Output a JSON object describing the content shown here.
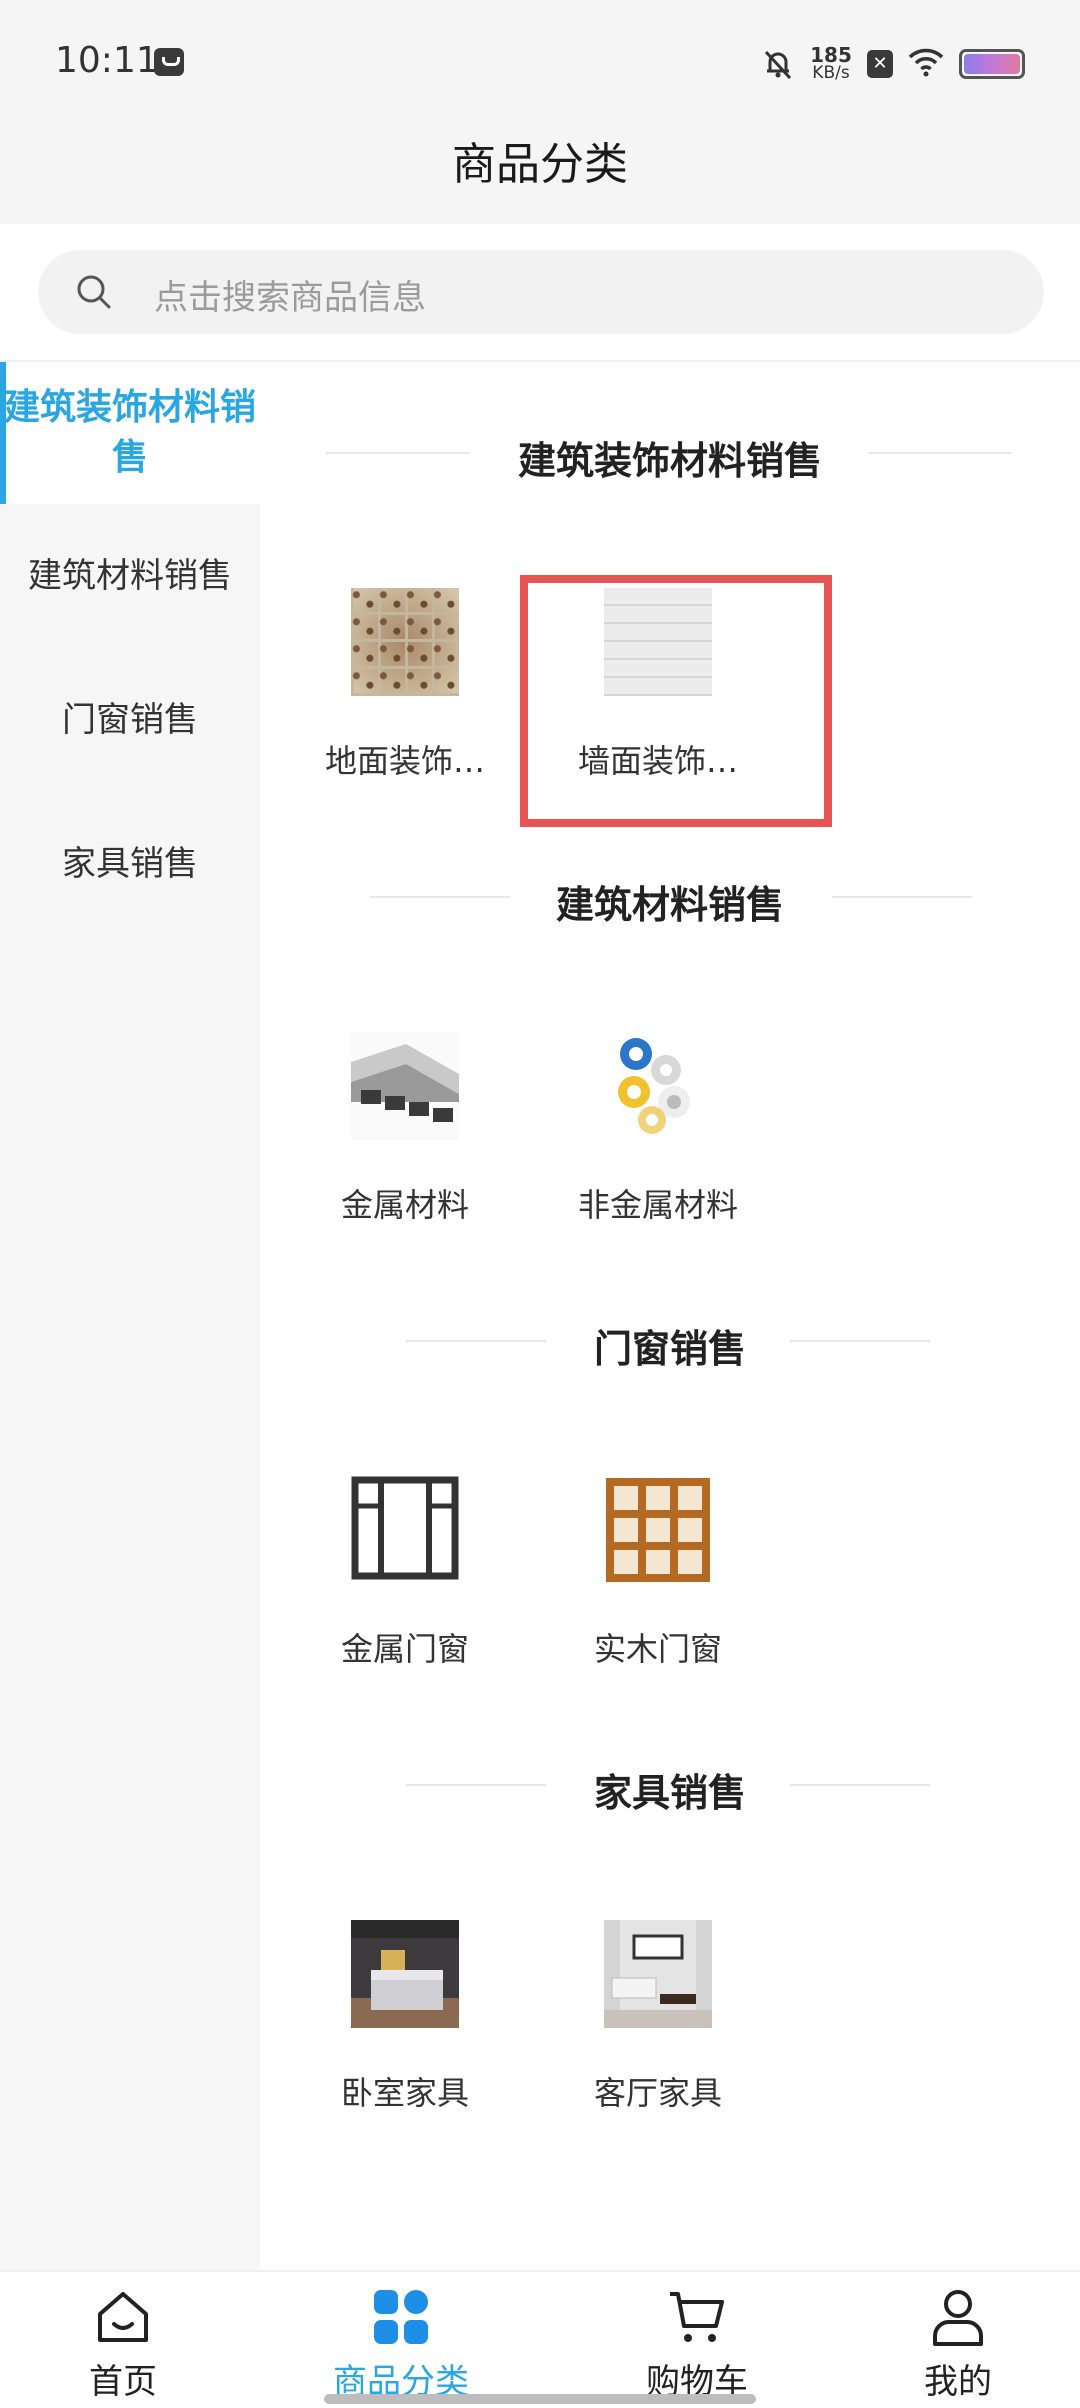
{
  "status_bar": {
    "time": "10:11",
    "net_speed_value": "185",
    "net_speed_unit": "KB/s"
  },
  "header": {
    "title": "商品分类"
  },
  "search": {
    "placeholder": "点击搜索商品信息"
  },
  "sidebar": {
    "items": [
      {
        "label": "建筑装饰材料销售",
        "active": true
      },
      {
        "label": "建筑材料销售",
        "active": false
      },
      {
        "label": "门窗销售",
        "active": false
      },
      {
        "label": "家具销售",
        "active": false
      }
    ]
  },
  "sections": [
    {
      "title": "建筑装饰材料销售",
      "items": [
        {
          "label": "地面装饰…",
          "image": "floor-tile-image"
        },
        {
          "label": "墙面装饰…",
          "image": "white-brick-wall-image"
        }
      ]
    },
    {
      "title": "建筑材料销售",
      "items": [
        {
          "label": "金属材料",
          "image": "metal-tube-image"
        },
        {
          "label": "非金属材料",
          "image": "tape-rolls-image"
        }
      ]
    },
    {
      "title": "门窗销售",
      "items": [
        {
          "label": "金属门窗",
          "image": "metal-window-image"
        },
        {
          "label": "实木门窗",
          "image": "wood-window-image"
        }
      ]
    },
    {
      "title": "家具销售",
      "items": [
        {
          "label": "卧室家具",
          "image": "bedroom-image"
        },
        {
          "label": "客厅家具",
          "image": "living-room-image"
        }
      ]
    }
  ],
  "bottom_nav": {
    "items": [
      {
        "label": "首页",
        "icon": "home-icon",
        "active": false
      },
      {
        "label": "商品分类",
        "icon": "category-icon",
        "active": true
      },
      {
        "label": "购物车",
        "icon": "cart-icon",
        "active": false
      },
      {
        "label": "我的",
        "icon": "user-icon",
        "active": false
      }
    ]
  },
  "colors": {
    "accent": "#2aa7e2",
    "highlight": "#e85454",
    "sidebar_bg": "#f6f6f6"
  }
}
